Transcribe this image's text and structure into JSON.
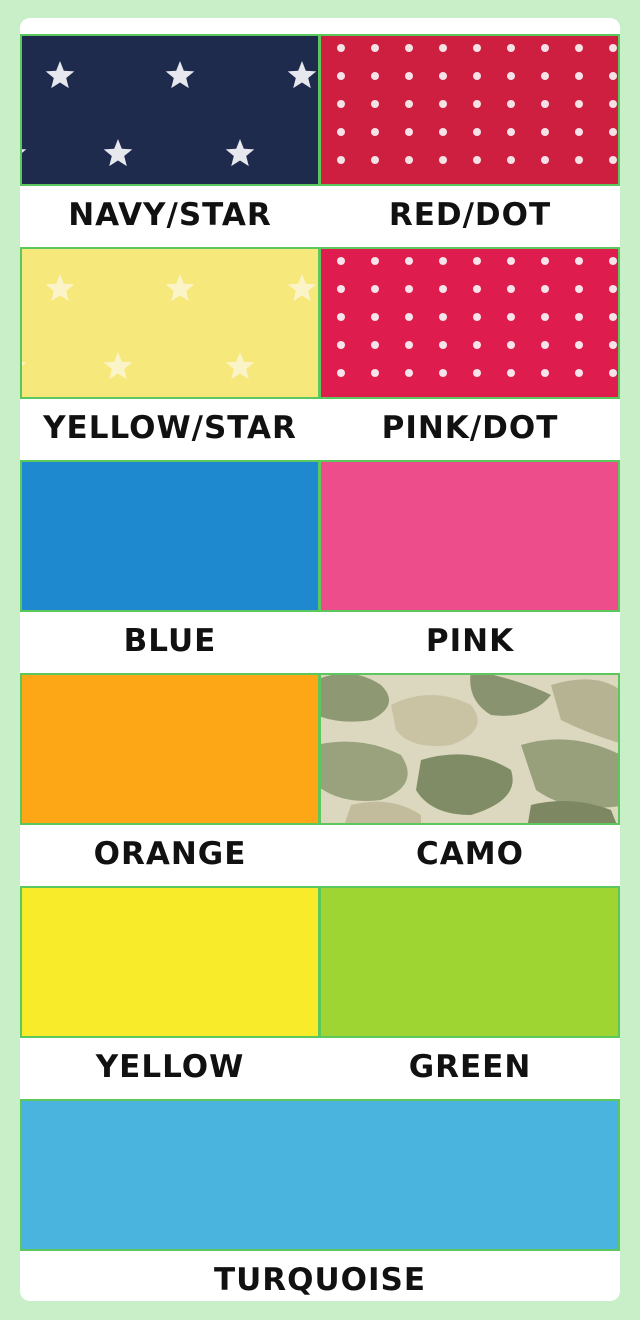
{
  "colors": [
    {
      "name": "NAVY/STAR",
      "base": "#1f2b4d",
      "pattern": "star",
      "accent": "#e6e8ee"
    },
    {
      "name": "RED/DOT",
      "base": "#cf1f40",
      "pattern": "dot",
      "accent": "#f6e2e6"
    },
    {
      "name": "YELLOW/STAR",
      "base": "#f6e87a",
      "pattern": "star",
      "accent": "#fbf4c9"
    },
    {
      "name": "PINK/DOT",
      "base": "#de1d4e",
      "pattern": "dot",
      "accent": "#f7e3ea"
    },
    {
      "name": "BLUE",
      "base": "#1f89cf",
      "pattern": "solid"
    },
    {
      "name": "PINK",
      "base": "#ee4d8c",
      "pattern": "solid"
    },
    {
      "name": "ORANGE",
      "base": "#fda616",
      "pattern": "solid"
    },
    {
      "name": "CAMO",
      "base": "#dcd7bf",
      "pattern": "camo",
      "accent": "#8a9673"
    },
    {
      "name": "YELLOW",
      "base": "#f8ec2a",
      "pattern": "solid"
    },
    {
      "name": "GREEN",
      "base": "#9ed532",
      "pattern": "solid"
    },
    {
      "name": "TURQUOISE",
      "base": "#4ab4df",
      "pattern": "solid"
    }
  ]
}
